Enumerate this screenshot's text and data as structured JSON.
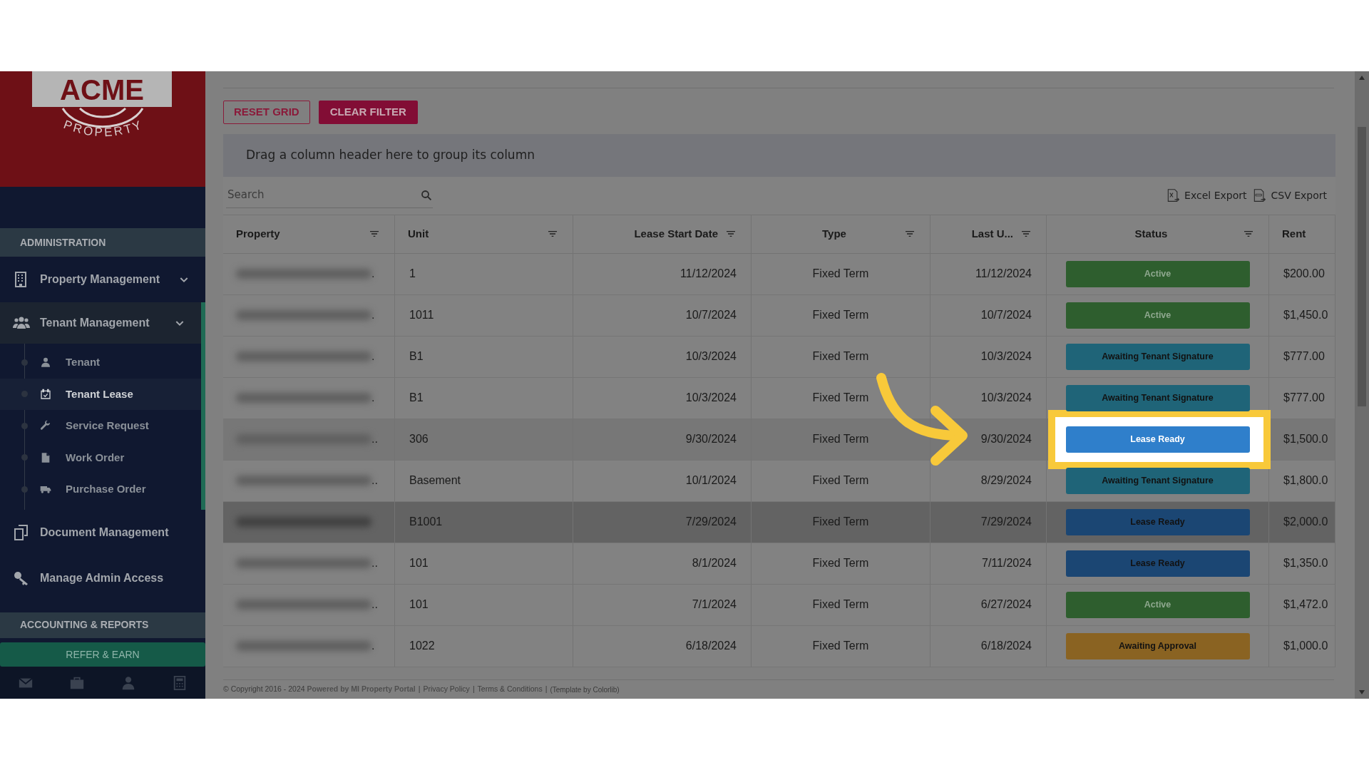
{
  "sidebar": {
    "logo_title": "ACME",
    "logo_subtitle": "PROPERTY",
    "items": [
      {
        "kind": "header",
        "label": "ADMINISTRATION"
      },
      {
        "kind": "dropdown",
        "label": "Property Management",
        "expanded": false
      },
      {
        "kind": "dropdown",
        "label": "Tenant Management",
        "expanded": true,
        "children": [
          {
            "label": "Tenant",
            "selected": false
          },
          {
            "label": "Tenant Lease",
            "selected": true
          },
          {
            "label": "Service Request",
            "selected": false
          },
          {
            "label": "Work Order",
            "selected": false
          },
          {
            "label": "Purchase Order",
            "selected": false
          }
        ]
      },
      {
        "kind": "link",
        "label": "Document Management"
      },
      {
        "kind": "link",
        "label": "Manage Admin Access"
      },
      {
        "kind": "header",
        "label": "ACCOUNTING & REPORTS"
      }
    ],
    "refer_button": "REFER & EARN"
  },
  "toolbar": {
    "buttons": [
      {
        "label": "RESET GRID",
        "kind": "outline"
      },
      {
        "label": "CLEAR FILTER",
        "kind": "filled"
      }
    ]
  },
  "group_panel": "Drag a column header here to group its column",
  "search": {
    "placeholder": "Search"
  },
  "exports": [
    "Excel Export",
    "CSV Export"
  ],
  "table": {
    "columns": [
      {
        "label": "Property",
        "filter": true
      },
      {
        "label": "Unit",
        "filter": true
      },
      {
        "label": "Lease Start Date",
        "filter": true
      },
      {
        "label": "Type",
        "filter": true
      },
      {
        "label": "Last U...",
        "filter": true
      },
      {
        "label": "Status",
        "filter": true
      },
      {
        "label": "Rent",
        "filter": false
      }
    ],
    "rows": [
      {
        "property": ".",
        "unit": "1",
        "lease_start": "11/12/2024",
        "type": "Fixed Term",
        "last_updated": "11/12/2024",
        "status": "Active",
        "color": "#2e5e2e",
        "rent": "$200.00",
        "selected": false,
        "highlighted": false
      },
      {
        "property": ".",
        "unit": "1011",
        "lease_start": "10/7/2024",
        "type": "Fixed Term",
        "last_updated": "10/7/2024",
        "status": "Active",
        "color": "#2e5e2e",
        "rent": "$1,450.0",
        "selected": false,
        "highlighted": false
      },
      {
        "property": ".",
        "unit": "B1",
        "lease_start": "10/3/2024",
        "type": "Fixed Term",
        "last_updated": "10/3/2024",
        "status": "Awaiting Tenant Signature",
        "color": "#1f6478",
        "rent": "$777.00",
        "selected": false,
        "highlighted": false
      },
      {
        "property": ".",
        "unit": "B1",
        "lease_start": "10/3/2024",
        "type": "Fixed Term",
        "last_updated": "10/3/2024",
        "status": "Awaiting Tenant Signature",
        "color": "#1f6478",
        "rent": "$777.00",
        "selected": false,
        "highlighted": false
      },
      {
        "property": "..",
        "unit": "306",
        "lease_start": "9/30/2024",
        "type": "Fixed Term",
        "last_updated": "9/30/2024",
        "status": "Lease Ready",
        "color": "#2f7fcb",
        "rent": "$1,500.0",
        "selected": false,
        "highlighted": true
      },
      {
        "property": "..",
        "unit": "Basement",
        "lease_start": "10/1/2024",
        "type": "Fixed Term",
        "last_updated": "8/29/2024",
        "status": "Awaiting Tenant Signature",
        "color": "#1f6478",
        "rent": "$1,800.0",
        "selected": false,
        "highlighted": false
      },
      {
        "property": "",
        "unit": "B1001",
        "lease_start": "7/29/2024",
        "type": "Fixed Term",
        "last_updated": "7/29/2024",
        "status": "Lease Ready",
        "color": "#1b4673",
        "rent": "$2,000.0",
        "selected": true,
        "highlighted": false
      },
      {
        "property": "..",
        "unit": "101",
        "lease_start": "8/1/2024",
        "type": "Fixed Term",
        "last_updated": "7/11/2024",
        "status": "Lease Ready",
        "color": "#1b4673",
        "rent": "$1,350.0",
        "selected": false,
        "highlighted": false
      },
      {
        "property": "..",
        "unit": "101",
        "lease_start": "7/1/2024",
        "type": "Fixed Term",
        "last_updated": "6/27/2024",
        "status": "Active",
        "color": "#2e5e2e",
        "rent": "$1,472.0",
        "selected": false,
        "highlighted": false
      },
      {
        "property": ".",
        "unit": "1022",
        "lease_start": "6/18/2024",
        "type": "Fixed Term",
        "last_updated": "6/18/2024",
        "status": "Awaiting Approval",
        "color": "#8a6322",
        "rent": "$1,000.0",
        "selected": false,
        "highlighted": false
      }
    ]
  },
  "footer": {
    "copyright": "© Copyright 2016 - 2024 **Powered by MI Property Portal**",
    "separator": "|",
    "links": [
      "Privacy Policy",
      "Terms & Conditions"
    ],
    "credit": "(Template by Colorlib)"
  }
}
